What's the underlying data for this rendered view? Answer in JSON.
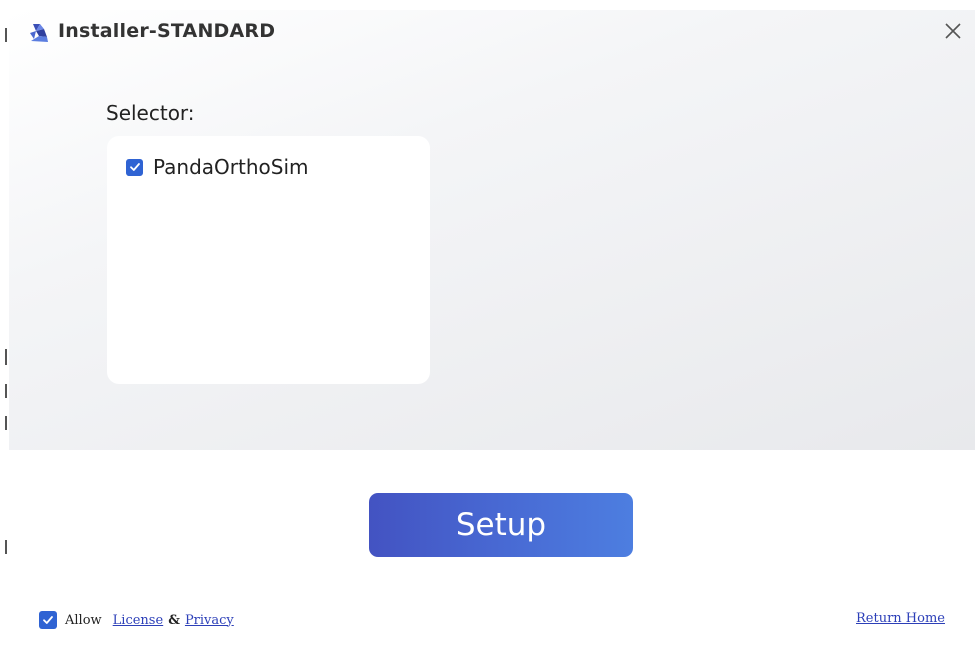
{
  "window": {
    "title": "Installer-STANDARD"
  },
  "selector": {
    "label": "Selector:",
    "items": [
      {
        "label": "PandaOrthoSim",
        "checked": true
      }
    ]
  },
  "actions": {
    "setup_label": "Setup"
  },
  "footer": {
    "allow_checked": true,
    "allow_label": "Allow",
    "license_link": "License",
    "ampersand": "&",
    "privacy_link": "Privacy",
    "return_home_link": "Return Home"
  },
  "colors": {
    "accent": "#2f63d3",
    "button_gradient_start": "#4353c2",
    "button_gradient_end": "#4d7ee0",
    "link": "#2c3fb8",
    "text": "#222222"
  },
  "icons": {
    "app": "app-logo-icon",
    "close": "close-icon",
    "check": "checkmark-icon"
  }
}
